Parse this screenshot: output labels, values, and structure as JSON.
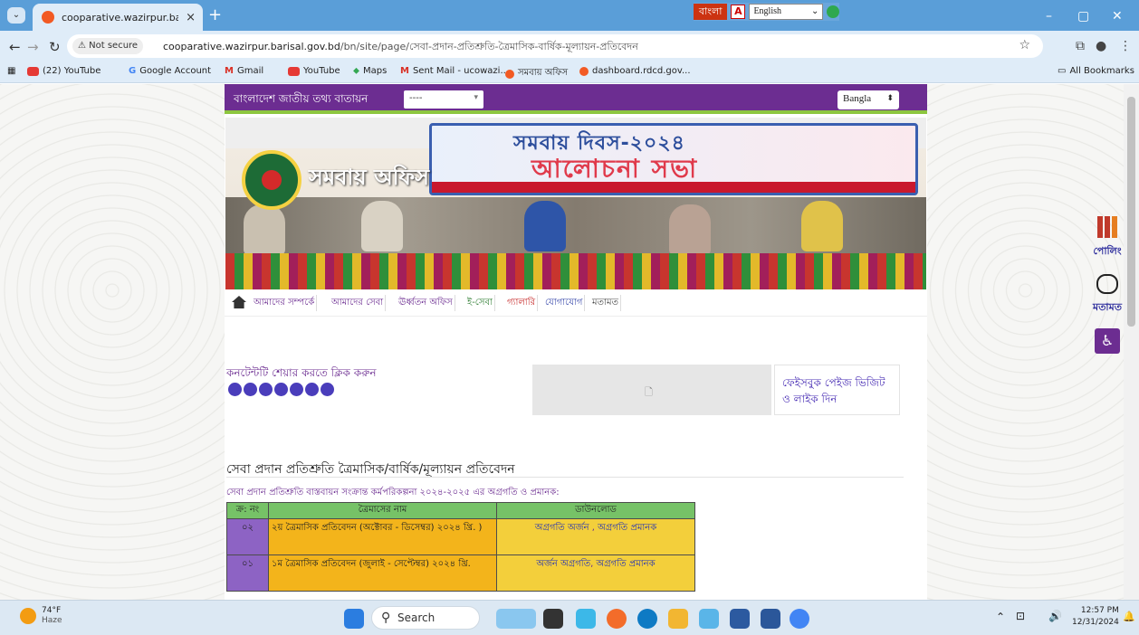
{
  "browser": {
    "tab_title": "cooparative.wazirpur.barisal.go",
    "tab_close": "×",
    "new_tab": "+",
    "lang_bangla": "বাংলা",
    "lang_select": "English",
    "win_min": "–",
    "win_max": "▢",
    "win_close": "✕",
    "not_secure": "⚠ Not secure",
    "url_domain": "cooparative.wazirpur.barisal.gov.bd",
    "url_path": "/bn/site/page/সেবা-প্রদান-প্রতিশ্রুতি-ত্রৈমাসিক-বার্ষিক-মূল্যায়ন-প্রতিবেদন",
    "bookmarks": [
      "(22) YouTube",
      "Google Account",
      "Gmail",
      "YouTube",
      "Maps",
      "Sent Mail - ucowazi...",
      "সমবায় অফিস",
      "dashboard.rdcd.gov...",
      "All Bookmarks"
    ],
    "colors": {
      "tabstrip": "#5a9ed8",
      "toolbar": "#dfecf8"
    }
  },
  "site": {
    "portal_label": "বাংলাদেশ জাতীয় তথ্য বাতায়ন",
    "office_dropdown": "----",
    "language": "Bangla",
    "office_name": "সমবায় অফিস",
    "poster_line1": "সমবায় দিবস-২০২৪",
    "poster_line2": "আলোচনা সভা",
    "menu": [
      "আমাদের সম্পর্কে",
      "আমাদের সেবা",
      "ঊর্ধ্বতন অফিস",
      "ই-সেবা",
      "গ্যালারি",
      "যোগাযোগ",
      "মতামত"
    ],
    "share_label": "কনটেন্টটি শেয়ার করতে ক্লিক করুন",
    "fb_label": "ফেইসবুক পেইজ ভিজিট ও লাইক দিন",
    "page_title": "সেবা প্রদান প্রতিশ্রুতি ত্রৈমাসিক/বার্ষিক/মূল্যায়ন প্রতিবেদন",
    "subtitle": "সেবা প্রদান প্রতিশ্রুতি বাস্তবায়ন সংক্রান্ত কর্মপরিকল্পনা ২০২৪-২০২৫ এর অগ্রগতি ও প্রমানক:",
    "table": {
      "headers": [
        "ক্র: নং",
        "ত্রৈমাসের নাম",
        "ডাউনলোড"
      ],
      "rows": [
        {
          "no": "০২",
          "name": "২য় ত্রৈমাসিক প্রতিবেদন (অক্টোবর - ডিসেম্বর) ২০২৪ খ্রি. )",
          "link1": "অগ্রগতি অর্জন",
          "sep": " , ",
          "link2": "অগ্রগতি প্রমানক"
        },
        {
          "no": "০১",
          "name": "১ম ত্রৈমাসিক প্রতিবেদন (জুলাই - সেপ্টেম্বর) ২০২৪ খ্রি.",
          "link1": "অর্জন অগ্রগতি",
          "sep": ", ",
          "link2": "অগ্রগতি প্রমানক"
        }
      ]
    },
    "widgets": {
      "poll": "পোলিং",
      "feedback": "মতামত"
    },
    "colors": {
      "primary": "#6c2d91",
      "accent": "#8dc63f",
      "row_number": "#8d63c4",
      "row_name": "#f3b41b",
      "row_download": "#f3cf3b",
      "header": "#76c267"
    }
  },
  "taskbar": {
    "weather_temp": "74°F",
    "weather_desc": "Haze",
    "search_placeholder": "Search",
    "time": "12:57 PM",
    "date": "12/31/2024"
  }
}
